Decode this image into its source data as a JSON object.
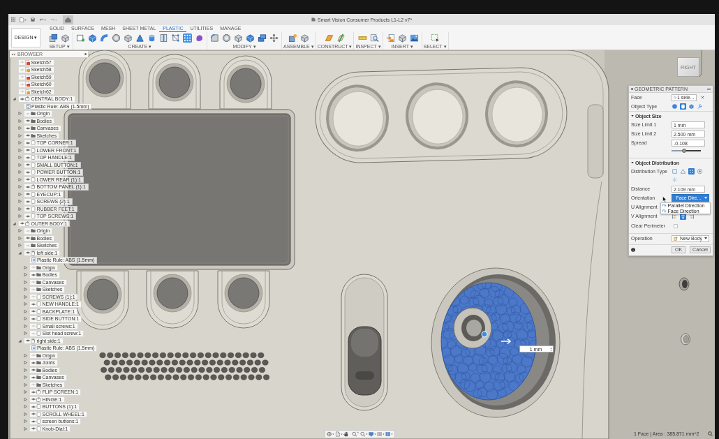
{
  "title_bar": {
    "title": "Smart Vision Consumer Products L1-L2 v7*"
  },
  "ribbon": {
    "workspace": "DESIGN ▾",
    "tabs": [
      {
        "label": "SOLID",
        "selected": false
      },
      {
        "label": "SURFACE",
        "selected": false
      },
      {
        "label": "MESH",
        "selected": false
      },
      {
        "label": "SHEET METAL",
        "selected": false
      },
      {
        "label": "PLASTIC",
        "selected": true
      },
      {
        "label": "UTILITIES",
        "selected": false
      },
      {
        "label": "MANAGE",
        "selected": false
      }
    ],
    "groups": [
      {
        "label": "SETUP ▾",
        "tools": [
          {
            "selected": false
          },
          {
            "selected": false
          }
        ]
      },
      {
        "label": "CREATE ▾",
        "tools": [
          {
            "selected": false
          },
          {
            "selected": false
          },
          {
            "selected": false
          },
          {
            "selected": false
          },
          {
            "selected": false
          },
          {
            "selected": false
          },
          {
            "selected": false
          },
          {
            "selected": false
          },
          {
            "selected": false
          },
          {
            "selected": true
          },
          {
            "selected": false
          }
        ]
      },
      {
        "label": "MODIFY ▾",
        "tools": [
          {
            "selected": false
          },
          {
            "selected": false
          },
          {
            "selected": false
          },
          {
            "selected": false
          },
          {
            "selected": false
          },
          {
            "selected": false
          }
        ]
      },
      {
        "label": "ASSEMBLE ▾",
        "tools": [
          {
            "selected": false
          },
          {
            "selected": false
          }
        ]
      },
      {
        "label": "CONSTRUCT ▾",
        "tools": [
          {
            "selected": false
          },
          {
            "selected": false
          }
        ]
      },
      {
        "label": "INSPECT ▾",
        "tools": [
          {
            "selected": false
          },
          {
            "selected": false
          }
        ]
      },
      {
        "label": "INSERT ▾",
        "tools": [
          {
            "selected": false
          },
          {
            "selected": false
          },
          {
            "selected": false
          }
        ]
      },
      {
        "label": "SELECT ▾",
        "tools": [
          {
            "selected": false
          }
        ]
      }
    ]
  },
  "browser": {
    "title": "BROWSER",
    "items": [
      {
        "label": "Sketch57",
        "kind": "sketch",
        "visible": false,
        "color": "#d8433b"
      },
      {
        "label": "Sketch58",
        "kind": "sketch",
        "visible": false,
        "color": "#e9a231"
      },
      {
        "label": "Sketch59",
        "kind": "sketch",
        "visible": false,
        "color": "#d8433b"
      },
      {
        "label": "Sketch60",
        "kind": "sketch",
        "visible": false,
        "color": "#d8433b"
      },
      {
        "label": "Sketch62",
        "kind": "sketch",
        "visible": false,
        "color": "#e9a231"
      },
      {
        "label": "CENTRAL BODY:1",
        "kind": "component",
        "expanded": true,
        "visible": true,
        "children": [
          {
            "label": "Plastic Rule: ABS (1.5mm)",
            "kind": "rule"
          },
          {
            "label": "Origin",
            "kind": "folder",
            "expanded": false,
            "visible": false
          },
          {
            "label": "Bodies",
            "kind": "folder",
            "expanded": false,
            "visible": true
          },
          {
            "label": "Canvases",
            "kind": "folder",
            "expanded": false,
            "visible": true
          },
          {
            "label": "Sketches",
            "kind": "folder",
            "expanded": false,
            "visible": true
          },
          {
            "label": "TOP CORNER:1",
            "kind": "part",
            "expanded": false,
            "visible": true
          },
          {
            "label": "LOWER FRONT:1",
            "kind": "part",
            "expanded": false,
            "visible": true
          },
          {
            "label": "TOP HANDLE:1",
            "kind": "part",
            "expanded": false,
            "visible": true
          },
          {
            "label": "SMALL BUTTON:1",
            "kind": "part",
            "expanded": false,
            "visible": true
          },
          {
            "label": "POWER BUTTON:1",
            "kind": "part",
            "expanded": false,
            "visible": true
          },
          {
            "label": "LOWER REAR (1):1",
            "kind": "part",
            "expanded": false,
            "visible": true
          },
          {
            "label": "BOTTOM PANEL (1):1",
            "kind": "component",
            "expanded": false,
            "visible": true
          },
          {
            "label": "EYECUP:1",
            "kind": "part",
            "expanded": false,
            "visible": true
          },
          {
            "label": "SCREWS (2):1",
            "kind": "part",
            "expanded": false,
            "visible": true
          },
          {
            "label": "RUBBER FEET:1",
            "kind": "part",
            "expanded": false,
            "visible": true
          },
          {
            "label": "TOP SCREWS:1",
            "kind": "part",
            "expanded": false,
            "visible": true
          }
        ]
      },
      {
        "label": "OUTER BODY:1",
        "kind": "component",
        "expanded": true,
        "visible": true,
        "children": [
          {
            "label": "Origin",
            "kind": "folder",
            "expanded": false,
            "visible": false
          },
          {
            "label": "Bodies",
            "kind": "folder",
            "expanded": false,
            "visible": true
          },
          {
            "label": "Sketches",
            "kind": "folder",
            "expanded": false,
            "visible": false
          },
          {
            "label": "left side:1",
            "kind": "component",
            "expanded": true,
            "visible": true,
            "children": [
              {
                "label": "Plastic Rule: ABS (1.5mm)",
                "kind": "rule"
              },
              {
                "label": "Origin",
                "kind": "folder",
                "expanded": false,
                "visible": false
              },
              {
                "label": "Bodies",
                "kind": "folder",
                "expanded": false,
                "visible": true
              },
              {
                "label": "Canvases",
                "kind": "folder",
                "expanded": false,
                "visible": false
              },
              {
                "label": "Sketches",
                "kind": "folder",
                "expanded": false,
                "visible": false
              },
              {
                "label": "SCREWS (1):1",
                "kind": "part",
                "expanded": false,
                "visible": false
              },
              {
                "label": "NEW HANDLE:1",
                "kind": "part",
                "expanded": false,
                "visible": true
              },
              {
                "label": "BACKPLATE:1",
                "kind": "part",
                "expanded": false,
                "visible": true
              },
              {
                "label": "SIDE BUTTON:1",
                "kind": "part",
                "expanded": false,
                "visible": true
              },
              {
                "label": "Small screws:1",
                "kind": "part",
                "expanded": false,
                "visible": false
              },
              {
                "label": "Slot head screw:1",
                "kind": "part",
                "expanded": false,
                "visible": false
              }
            ]
          },
          {
            "label": "right side:1",
            "kind": "component",
            "expanded": true,
            "visible": true,
            "children": [
              {
                "label": "Plastic Rule: ABS (1.5mm)",
                "kind": "rule"
              },
              {
                "label": "Origin",
                "kind": "folder",
                "expanded": false,
                "visible": false
              },
              {
                "label": "Joints",
                "kind": "folder",
                "expanded": false,
                "visible": true
              },
              {
                "label": "Bodies",
                "kind": "folder",
                "expanded": false,
                "visible": true
              },
              {
                "label": "Canvases",
                "kind": "folder",
                "expanded": false,
                "visible": true
              },
              {
                "label": "Sketches",
                "kind": "folder",
                "expanded": false,
                "visible": false
              },
              {
                "label": "FLIP SCREEN:1",
                "kind": "component",
                "expanded": false,
                "visible": true
              },
              {
                "label": "HINGE:1",
                "kind": "component",
                "expanded": false,
                "visible": true
              },
              {
                "label": "BUTTONS (1):1",
                "kind": "part",
                "expanded": false,
                "visible": true
              },
              {
                "label": "SCROLL WHEEL:1",
                "kind": "part",
                "expanded": false,
                "visible": true
              },
              {
                "label": "screen buttons:1",
                "kind": "part",
                "expanded": false,
                "visible": true
              },
              {
                "label": "Knob-Dial:1",
                "kind": "part",
                "expanded": false,
                "visible": true
              }
            ]
          }
        ]
      }
    ]
  },
  "dialog": {
    "title": "GEOMETRIC PATTERN",
    "rows": [
      {
        "kind": "selection",
        "label": "Face",
        "value": "1 sele..."
      },
      {
        "kind": "icons",
        "label": "Object Type",
        "options": [
          {
            "selected": false
          },
          {
            "selected": true
          },
          {
            "selected": false
          },
          {
            "selected": false
          }
        ]
      },
      {
        "kind": "section",
        "label": "Object Size",
        "expanded": true
      },
      {
        "kind": "input",
        "label": "Size Limit 1",
        "value": "1 mm"
      },
      {
        "kind": "input",
        "label": "Size Limit 2",
        "value": "2.500 mm"
      },
      {
        "kind": "input",
        "label": "Spread",
        "value": "-0.108"
      },
      {
        "kind": "slider",
        "level": 0.44
      },
      {
        "kind": "section",
        "label": "Object Distribution",
        "expanded": true
      },
      {
        "kind": "icons",
        "label": "Distribution Type",
        "options": [
          {
            "selected": false
          },
          {
            "selected": false
          },
          {
            "selected": true
          },
          {
            "selected": false
          },
          {
            "selected": false
          }
        ]
      },
      {
        "kind": "input",
        "label": "Distance",
        "value": "2.109 mm"
      },
      {
        "kind": "dropdown",
        "label": "Orientation",
        "value": "Face Dire...",
        "open": true
      },
      {
        "kind": "icons",
        "label": "U Alignment"
      },
      {
        "kind": "icons",
        "label": "V Alignment",
        "options": [
          {
            "selected": false
          },
          {
            "selected": true
          },
          {
            "selected": false
          }
        ]
      },
      {
        "kind": "checkbox",
        "label": "Clear Perimeter",
        "checked": false
      },
      {
        "kind": "operation",
        "label": "Operation",
        "value": "New Body",
        "open": false
      }
    ],
    "menu": {
      "items": [
        {
          "label": "Parallel Direction"
        },
        {
          "label": "Face Direction"
        }
      ]
    },
    "buttons": [
      "OK",
      "Cancel"
    ]
  },
  "dimension": {
    "value": "1 mm"
  },
  "view_cube": {
    "face": "RIGHT"
  },
  "status_bar": {
    "text": "1 Face | Area : 385.871 mm^2"
  }
}
